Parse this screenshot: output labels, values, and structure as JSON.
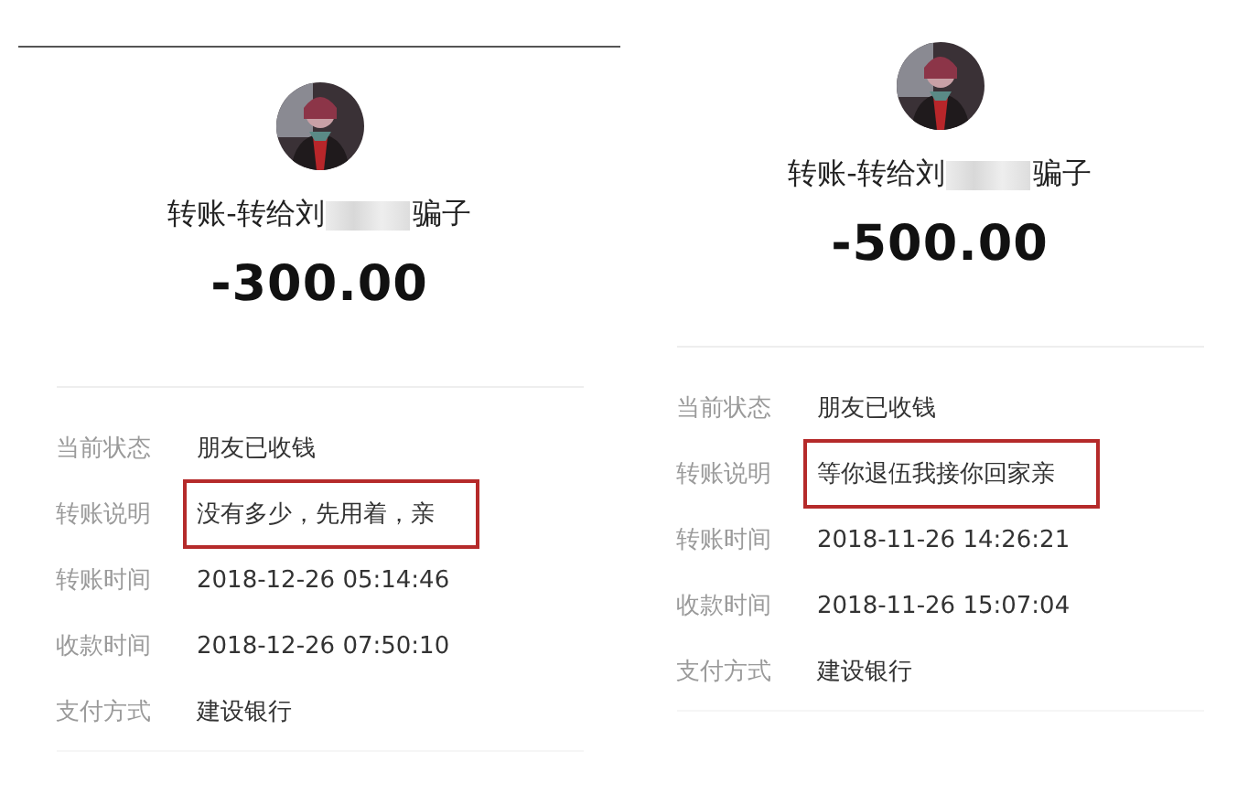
{
  "panels": [
    {
      "title_start": "转账-转给刘",
      "title_end": "骗子",
      "amount": "-300.00",
      "rows": [
        {
          "label": "当前状态",
          "value": "朋友已收钱",
          "highlighted": false
        },
        {
          "label": "转账说明",
          "value": "没有多少，先用着，亲",
          "highlighted": true
        },
        {
          "label": "转账时间",
          "value": "2018-12-26 05:14:46",
          "highlighted": false
        },
        {
          "label": "收款时间",
          "value": "2018-12-26 07:50:10",
          "highlighted": false
        },
        {
          "label": "支付方式",
          "value": "建设银行",
          "highlighted": false
        }
      ]
    },
    {
      "title_start": "转账-转给刘",
      "title_end": "骗子",
      "amount": "-500.00",
      "rows": [
        {
          "label": "当前状态",
          "value": "朋友已收钱",
          "highlighted": false
        },
        {
          "label": "转账说明",
          "value": "等你退伍我接你回家亲",
          "highlighted": true
        },
        {
          "label": "转账时间",
          "value": "2018-11-26 14:26:21",
          "highlighted": false
        },
        {
          "label": "收款时间",
          "value": "2018-11-26 15:07:04",
          "highlighted": false
        },
        {
          "label": "支付方式",
          "value": "建设银行",
          "highlighted": false
        }
      ]
    }
  ]
}
